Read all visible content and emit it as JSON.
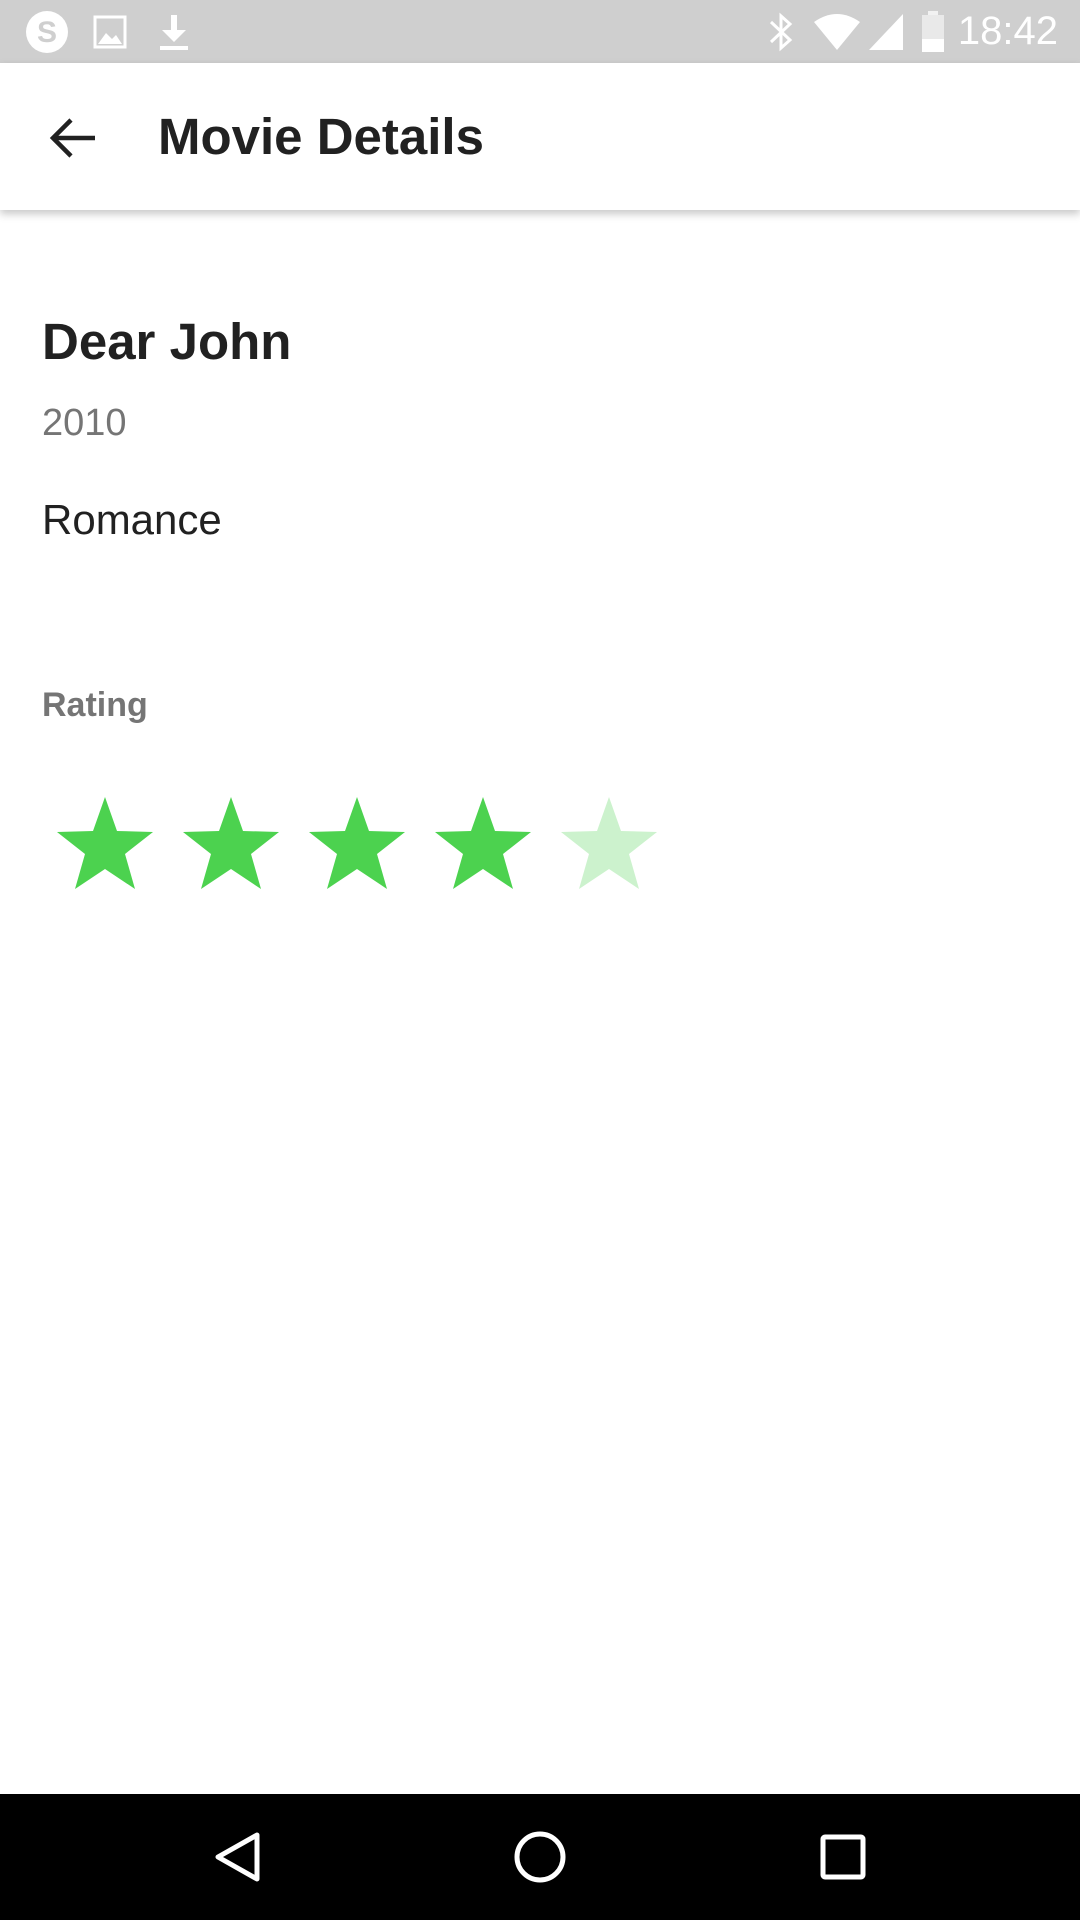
{
  "status_bar": {
    "time": "18:42",
    "icons_left": [
      "skype-icon",
      "image-icon",
      "download-icon"
    ],
    "icons_right": [
      "bluetooth-icon",
      "wifi-icon",
      "signal-icon",
      "battery-icon"
    ]
  },
  "app_bar": {
    "title": "Movie Details",
    "back_icon": "arrow-back-icon"
  },
  "movie": {
    "title": "Dear John",
    "year": "2010",
    "genre": "Romance"
  },
  "rating": {
    "label": "Rating",
    "value": 4,
    "max": 5,
    "filled_color": "#4cd24f",
    "empty_color": "#ccf2cd"
  },
  "nav_bar": {
    "buttons": [
      "back-nav-icon",
      "home-nav-icon",
      "recents-nav-icon"
    ]
  }
}
